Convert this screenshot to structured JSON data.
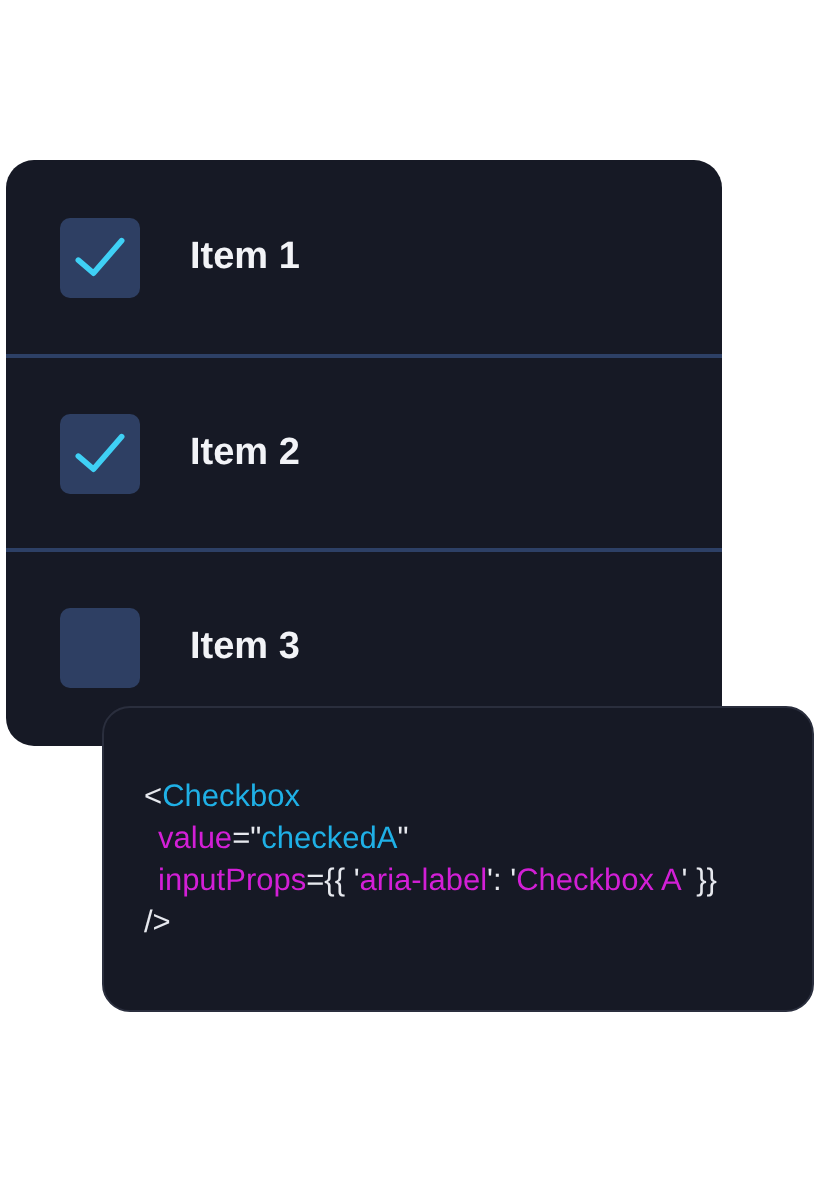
{
  "items": [
    {
      "label": "Item 1",
      "checked": true
    },
    {
      "label": "Item 2",
      "checked": true
    },
    {
      "label": "Item 3",
      "checked": false
    }
  ],
  "code": [
    {
      "indented": false,
      "tokens": [
        {
          "kind": "punct",
          "text": "<"
        },
        {
          "kind": "tag",
          "text": "Checkbox"
        }
      ]
    },
    {
      "indented": true,
      "tokens": [
        {
          "kind": "attr",
          "text": "value"
        },
        {
          "kind": "punct",
          "text": "=\""
        },
        {
          "kind": "tag",
          "text": "checkedA"
        },
        {
          "kind": "punct",
          "text": "\""
        }
      ]
    },
    {
      "indented": true,
      "tokens": [
        {
          "kind": "attr",
          "text": "inputProps"
        },
        {
          "kind": "punct",
          "text": "={{ '"
        },
        {
          "kind": "attr",
          "text": "aria-label"
        },
        {
          "kind": "punct",
          "text": "': '"
        },
        {
          "kind": "attr",
          "text": "Checkbox A"
        },
        {
          "kind": "punct",
          "text": "' }}"
        }
      ]
    },
    {
      "indented": false,
      "tokens": [
        {
          "kind": "punct",
          "text": "/>"
        }
      ]
    }
  ]
}
